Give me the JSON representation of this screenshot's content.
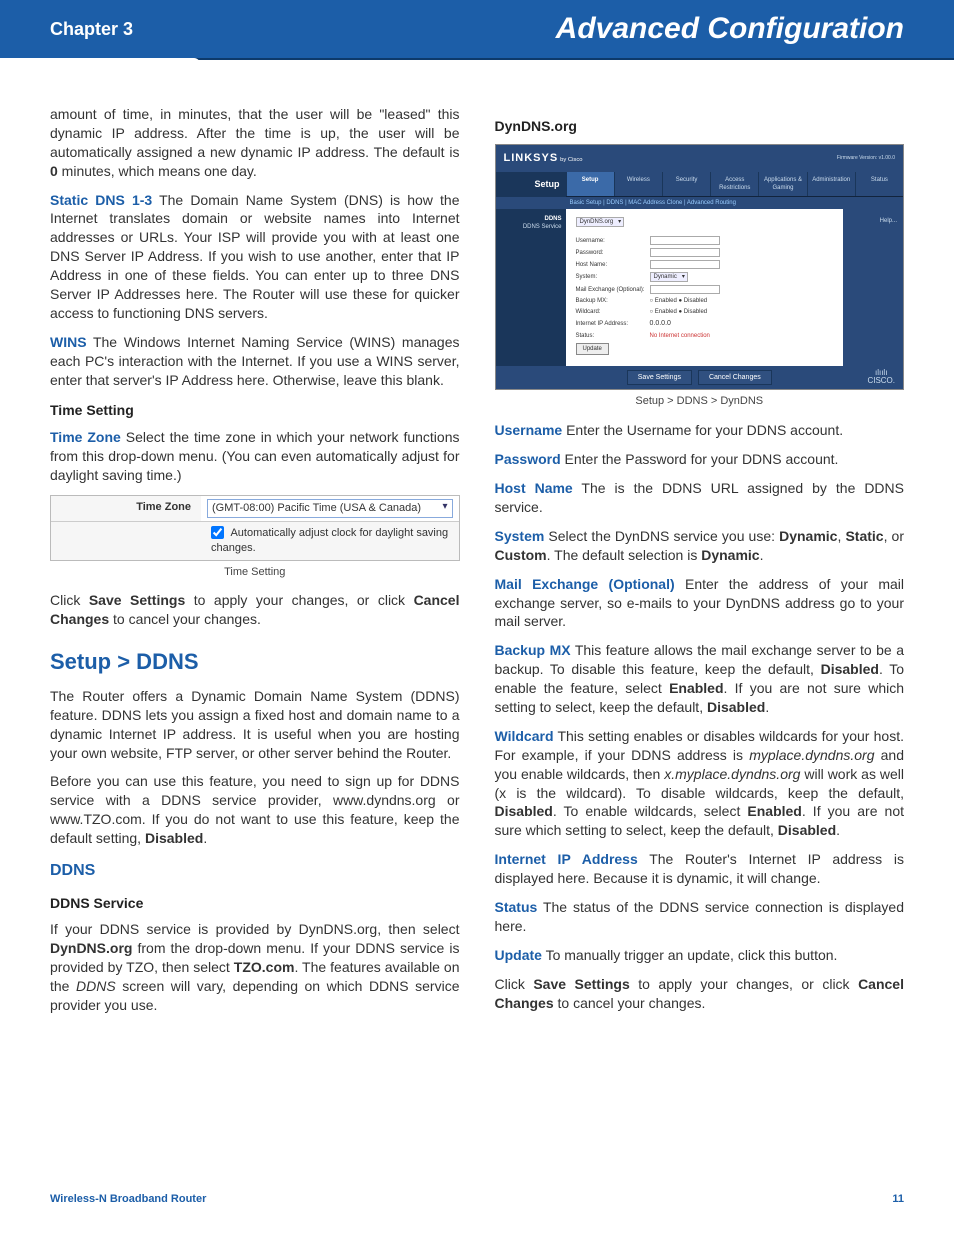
{
  "header": {
    "chapter": "Chapter 3",
    "title": "Advanced Configuration"
  },
  "left": {
    "p1": "amount of time, in minutes, that the user will be \"leased\" this dynamic IP address. After the time is up, the user will be automatically assigned a new dynamic IP address. The default is ",
    "p1_bold": "0",
    "p1_tail": " minutes, which means one day.",
    "dns_term": "Static DNS 1-3",
    "dns_body": "  The Domain Name System (DNS) is how the Internet translates domain or website names into Internet addresses or URLs. Your ISP will provide you with at least one DNS Server IP Address. If you wish to use another, enter that IP Address in one of these fields. You can enter up to three DNS Server IP Addresses here. The Router will use these for quicker access to functioning DNS servers.",
    "wins_term": "WINS",
    "wins_body": " The Windows Internet Naming Service (WINS) manages each PC's interaction with the Internet. If you use a WINS server, enter that server's IP Address here. Otherwise, leave this blank.",
    "time_heading": "Time Setting",
    "tz_term": "Time Zone",
    "tz_body": "  Select the time zone in which your network functions from this drop-down menu. (You can even automatically adjust for daylight saving time.)",
    "tz_widget": {
      "label": "Time Zone",
      "value": "(GMT-08:00) Pacific Time (USA & Canada)",
      "checkbox": "Automatically adjust clock for daylight saving changes."
    },
    "tz_caption": "Time Setting",
    "save_p_a": "Click ",
    "save_b1": "Save Settings",
    "save_p_b": " to apply your changes, or click ",
    "save_b2": "Cancel Changes",
    "save_p_c": " to cancel your changes.",
    "section_ddns": "Setup > DDNS",
    "ddns_p1": "The Router offers a Dynamic Domain Name System (DDNS) feature. DDNS lets you assign a fixed host and domain name to a dynamic Internet IP address. It is useful when you are hosting your own website, FTP server, or other server behind the Router.",
    "ddns_p2_a": "Before you can use this feature, you need to sign up for DDNS service with a DDNS service provider, www.dyndns.org or www.TZO.com. If you do not want to use this feature, keep the default setting, ",
    "ddns_p2_b": "Disabled",
    "ddns_p2_c": ".",
    "ddns_sub": "DDNS",
    "ddns_service_h": "DDNS Service",
    "ddns_service_p_a": "If your DDNS service is provided by DynDNS.org, then select ",
    "ddns_service_b1": "DynDNS.org",
    "ddns_service_p_b": " from the drop-down menu. If your DDNS service is provided by TZO, then select ",
    "ddns_service_b2": "TZO.com",
    "ddns_service_p_c": ". The features available on the ",
    "ddns_service_i": "DDNS",
    "ddns_service_p_d": " screen will vary, depending on which DDNS service provider you use."
  },
  "right": {
    "dyndns_h": "DynDNS.org",
    "fig": {
      "brand": "LINKSYS",
      "brand_sub": "by Cisco",
      "fw": "Firmware Version: v1.00.0",
      "nav_left": "Setup",
      "tabs": [
        "Setup",
        "Wireless",
        "Security",
        "Access Restrictions",
        "Applications & Gaming",
        "Administration",
        "Status"
      ],
      "subtabs": "Basic Setup   |   DDNS   |   MAC Address Clone   |   Advanced Routing",
      "side1": "DDNS",
      "side2": "DDNS Service",
      "help": "Help...",
      "service_val": "DynDNS.org",
      "fields": {
        "username": "Username:",
        "password": "Password:",
        "hostname": "Host Name:",
        "system": "System:",
        "system_val": "Dynamic",
        "mx": "Mail Exchange (Optional):",
        "backup": "Backup MX:",
        "wildcard": "Wildcard:",
        "enabled": "Enabled",
        "disabled": "Disabled",
        "ip": "Internet IP Address:",
        "ip_val": "0.0.0.0",
        "status": "Status:",
        "status_val": "No Internet connection",
        "update": "Update"
      },
      "save": "Save Settings",
      "cancel": "Cancel Changes",
      "cisco": "CISCO."
    },
    "fig_caption": "Setup > DDNS > DynDNS",
    "un_term": "Username",
    "un_body": "  Enter the Username for your DDNS account.",
    "pw_term": "Password",
    "pw_body": "  Enter the Password for your DDNS account.",
    "hn_term": "Host Name",
    "hn_body": "  The is the DDNS URL assigned by the DDNS service.",
    "sys_term": "System",
    "sys_a": "  Select the DynDNS service you use: ",
    "sys_b1": "Dynamic",
    "sys_b": ", ",
    "sys_b2": "Static",
    "sys_c": ", or ",
    "sys_b3": "Custom",
    "sys_d": ". The default selection is ",
    "sys_b4": "Dynamic",
    "sys_e": ".",
    "mx_term": "Mail Exchange (Optional)",
    "mx_body": "  Enter the address of your mail exchange server, so e-mails to your DynDNS address go to your mail server.",
    "bmx_term": "Backup MX",
    "bmx_a": "  This feature allows the mail exchange server to be a backup. To disable this feature, keep the default, ",
    "bmx_b1": "Disabled",
    "bmx_b": ". To enable the feature, select ",
    "bmx_b2": "Enabled",
    "bmx_c": ". If you are not sure which setting to select, keep the default, ",
    "bmx_b3": "Disabled",
    "bmx_d": ".",
    "wc_term": "Wildcard",
    "wc_a": "  This setting enables or disables wildcards for your host. For example, if your DDNS address is ",
    "wc_i1": "myplace.dyndns.org",
    "wc_b": " and you enable wildcards, then ",
    "wc_i2": "x.myplace.dyndns.org",
    "wc_c": " will work as well (x is the wildcard). To disable wildcards, keep the default, ",
    "wc_b1": "Disabled",
    "wc_d": ". To enable wildcards, select ",
    "wc_b2": "Enabled",
    "wc_e": ". If you are not sure which setting to select, keep the default, ",
    "wc_b3": "Disabled",
    "wc_f": ".",
    "ip_term": "Internet IP Address",
    "ip_body": "  The Router's Internet IP address is displayed here. Because it is dynamic, it will change.",
    "st_term": "Status",
    "st_body": "  The status of the DDNS service connection is displayed here.",
    "up_term": "Update",
    "up_body": "  To manually trigger an update, click this button.",
    "save_a": "Click ",
    "save_b1": "Save Settings",
    "save_b": " to apply your changes, or click ",
    "save_b2": "Cancel Changes",
    "save_c": " to cancel your changes."
  },
  "footer": {
    "product": "Wireless-N Broadband Router",
    "page": "11"
  }
}
